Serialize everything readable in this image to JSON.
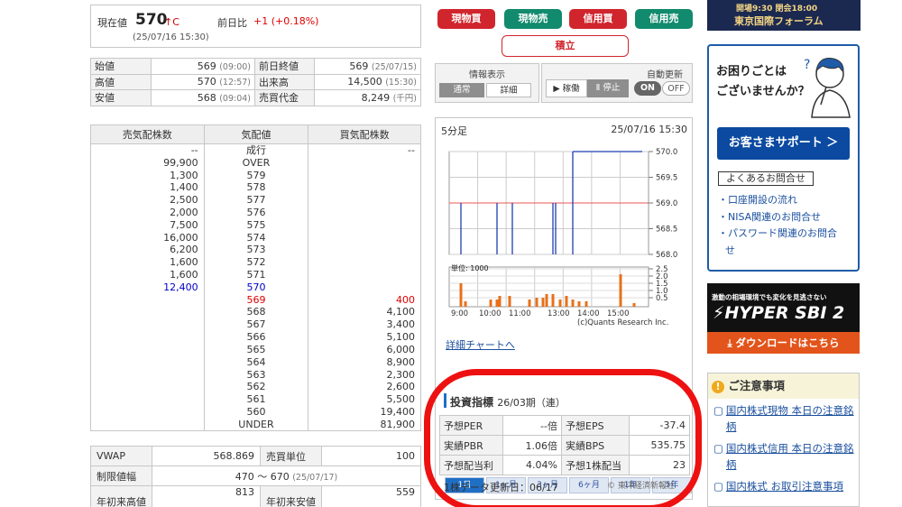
{
  "price": {
    "label": "現在値",
    "value": "570",
    "tag": "↑C",
    "time": "(25/07/16 15:30)",
    "change_label": "前日比",
    "change_value": "+1 (+0.18%)"
  },
  "ohlc": [
    {
      "h1": "始値",
      "v1": "569",
      "t1": "(09:00)",
      "h2": "前日終値",
      "v2": "569",
      "t2": "(25/07/15)"
    },
    {
      "h1": "高値",
      "v1": "570",
      "t1": "(12:57)",
      "h2": "出来高",
      "v2": "14,500",
      "t2": "(15:30)"
    },
    {
      "h1": "安値",
      "v1": "568",
      "t1": "(09:04)",
      "h2": "売買代金",
      "v2": "8,249",
      "t2": "(千円)"
    }
  ],
  "board": {
    "headers": [
      "売気配株数",
      "気配値",
      "買気配株数"
    ],
    "rows": [
      {
        "sell": "--",
        "price": "成行",
        "buy": "--"
      },
      {
        "sell": "99,900",
        "price": "OVER",
        "buy": ""
      },
      {
        "sell": "1,300",
        "price": "579",
        "buy": ""
      },
      {
        "sell": "1,400",
        "price": "578",
        "buy": ""
      },
      {
        "sell": "2,500",
        "price": "577",
        "buy": ""
      },
      {
        "sell": "2,000",
        "price": "576",
        "buy": ""
      },
      {
        "sell": "7,500",
        "price": "575",
        "buy": ""
      },
      {
        "sell": "16,000",
        "price": "574",
        "buy": ""
      },
      {
        "sell": "6,200",
        "price": "573",
        "buy": ""
      },
      {
        "sell": "1,600",
        "price": "572",
        "buy": ""
      },
      {
        "sell": "1,600",
        "price": "571",
        "buy": ""
      },
      {
        "sell": "12,400",
        "price": "570",
        "buy": "",
        "hl": "blue"
      },
      {
        "sell": "",
        "price": "569",
        "buy": "400",
        "hl": "red"
      },
      {
        "sell": "",
        "price": "568",
        "buy": "4,100"
      },
      {
        "sell": "",
        "price": "567",
        "buy": "3,400"
      },
      {
        "sell": "",
        "price": "566",
        "buy": "5,100"
      },
      {
        "sell": "",
        "price": "565",
        "buy": "6,000"
      },
      {
        "sell": "",
        "price": "564",
        "buy": "8,900"
      },
      {
        "sell": "",
        "price": "563",
        "buy": "2,300"
      },
      {
        "sell": "",
        "price": "562",
        "buy": "2,600"
      },
      {
        "sell": "",
        "price": "561",
        "buy": "5,500"
      },
      {
        "sell": "",
        "price": "560",
        "buy": "19,400"
      },
      {
        "sell": "",
        "price": "UNDER",
        "buy": "81,900"
      }
    ]
  },
  "stats": {
    "vwap_label": "VWAP",
    "vwap": "568.869",
    "unit_label": "売買単位",
    "unit": "100",
    "limit_label": "制限値幅",
    "limit": "470 〜 670",
    "limit_date": "(25/07/17)",
    "ytd_high_label": "年初来高値",
    "ytd_high": "813",
    "ytd_low_label": "年初来安値",
    "ytd_low": "559"
  },
  "trade_buttons": [
    "現物買",
    "現物売",
    "信用買",
    "信用売"
  ],
  "tsumitate": "積立",
  "info_display": {
    "title": "情報表示",
    "normal": "通常",
    "detail": "詳細"
  },
  "auto_update": {
    "title": "自動更新",
    "run": "▶ 稼働",
    "stop": "Ⅱ 停止",
    "on": "ON",
    "off": "OFF"
  },
  "chart": {
    "period": "5分足",
    "timestamp": "25/07/16 15:30",
    "price_ticks": [
      "570.0",
      "569.5",
      "569.0",
      "568.5",
      "568.0"
    ],
    "volume_unit": "単位: 1000",
    "volume_ticks": [
      "2.5",
      "2.0",
      "1.5",
      "1.0",
      "0.5"
    ],
    "time_ticks": [
      "9:00",
      "10:00",
      "11:00",
      "13:00",
      "14:00",
      "15:00"
    ],
    "credit": "(c)Quants Research Inc.",
    "detail_link": "詳細チャートへ",
    "tabs": [
      "1日",
      "1ヶ月",
      "3ヶ月",
      "6ヶ月",
      "1年",
      "5年"
    ]
  },
  "chart_data": {
    "type": "bar",
    "title": "",
    "x_range": [
      "9:00",
      "15:30"
    ],
    "price_range": [
      568.0,
      570.0
    ],
    "previous_close": 569.0,
    "volume_unit": 1000
  },
  "indicators": {
    "title": "投資指標",
    "period": "26/03期（連）",
    "rows": [
      {
        "h1": "予想PER",
        "v1": "--倍",
        "h2": "予想EPS",
        "v2": "-37.4"
      },
      {
        "h1": "実績PBR",
        "v1": "1.06倍",
        "h2": "実績BPS",
        "v2": "535.75"
      },
      {
        "h1": "予想配当利",
        "v1": "4.04%",
        "h2": "予想1株配当",
        "v2": "23"
      }
    ],
    "update": "1株データ更新日：06/17",
    "source": "© 東洋経済新報社"
  },
  "right": {
    "banner_text": "開場9:30 閉会18:00",
    "banner_sub": "東京国際フォーラム",
    "support_q1": "お困りごとは",
    "support_q2": "ございませんか？",
    "support_btn": "お客さまサポート ＞",
    "faq": "よくあるお問合せ",
    "faq_items": [
      "・口座開設の流れ",
      "・NISA関連のお問合せ",
      "・パスワード関連のお問合",
      "せ"
    ],
    "hyper_tag": "激動の相場環境でも変化を見逃さない",
    "hyper_title": "HYPER SBI 2",
    "hyper_dl": "ダウンロードはこちら",
    "notice_title": "ご注意事項",
    "notice_links": [
      "国内株式現物 本日の注意銘柄",
      "国内株式信用 本日の注意銘柄",
      "国内株式 お取引注意事項"
    ]
  }
}
